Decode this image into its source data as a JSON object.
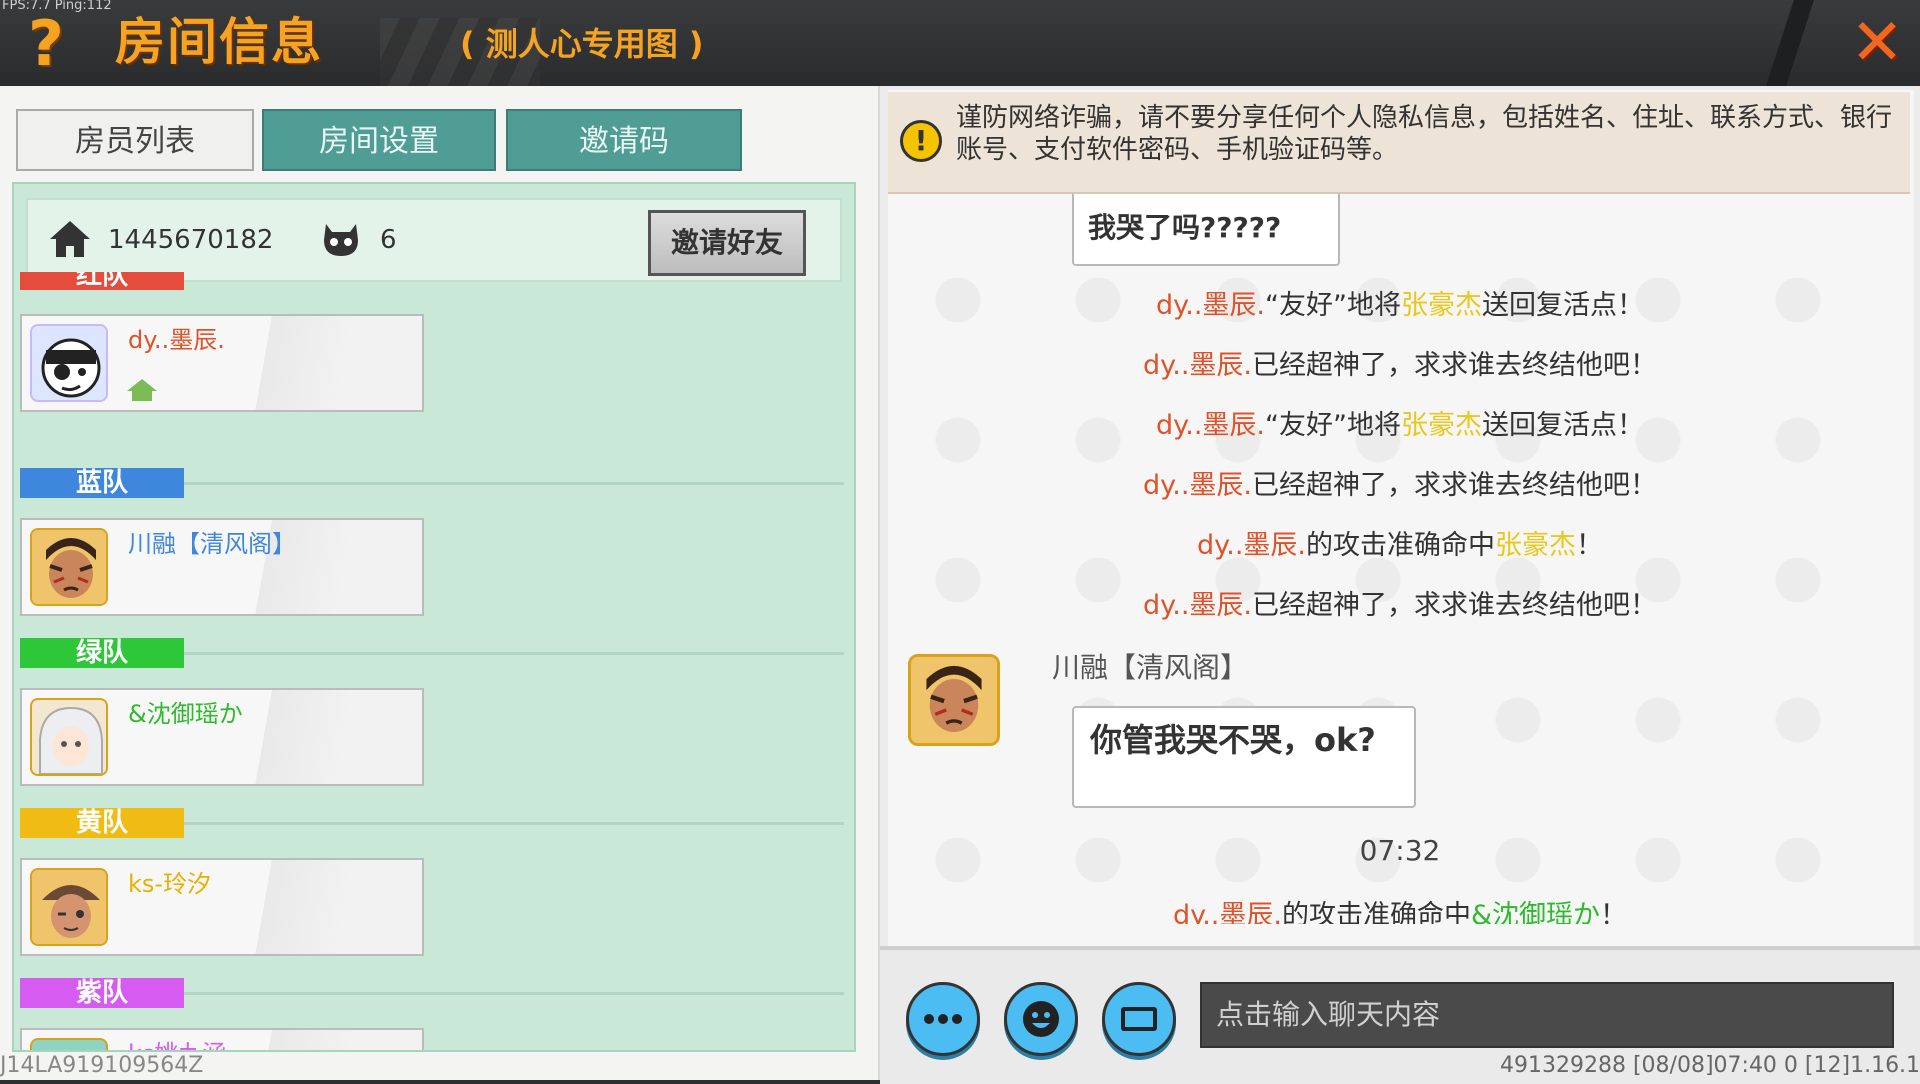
{
  "status": {
    "fps": "FPS:7.7  Ping:112"
  },
  "header": {
    "help_label": "?",
    "title": "房间信息",
    "subtitle": "( 测人心专用图 )",
    "close_label": "✕"
  },
  "tabs": [
    {
      "label": "房员列表",
      "active": true
    },
    {
      "label": "房间设置",
      "active": false
    },
    {
      "label": "邀请码",
      "active": false
    }
  ],
  "room": {
    "id": "1445670182",
    "people": "6",
    "invite_button": "邀请好友"
  },
  "teams": [
    {
      "name": "红队",
      "color": "#e54c3c",
      "members": [
        {
          "name": "dy..墨辰.",
          "color": "#e0522a",
          "avatar_icon": "pirate-avatar-icon"
        }
      ]
    },
    {
      "name": "蓝队",
      "color": "#3f86dd",
      "members": [
        {
          "name": "川融【清风阁】",
          "color": "#3f86dd",
          "avatar_icon": "warrior-avatar-icon"
        }
      ]
    },
    {
      "name": "绿队",
      "color": "#2ec73a",
      "members": [
        {
          "name": "&沈御瑶か",
          "color": "#2dbb2d",
          "avatar_icon": "white-hair-avatar-icon"
        }
      ]
    },
    {
      "name": "黄队",
      "color": "#f0bb12",
      "members": [
        {
          "name": "ks-玲汐",
          "color": "#e8b000",
          "avatar_icon": "hat-girl-avatar-icon"
        }
      ]
    },
    {
      "name": "紫队",
      "color": "#d65bf0",
      "members": [
        {
          "name": "ks姚九涵",
          "color": "#d65bf0",
          "avatar_icon": "avatar-icon"
        }
      ]
    }
  ],
  "warning": {
    "icon": "exclamation-icon",
    "text": "谨防网络诈骗，请不要分享任何个人隐私信息，包括姓名、住址、联系方式、银行账号、支付软件密码、手机验证码等。"
  },
  "chat": {
    "partial_bubble": "我哭了吗?????",
    "lines": [
      {
        "name": "dy..墨辰.",
        "mid": "“友好”地将",
        "target": "张豪杰",
        "end": "送回复活点！"
      },
      {
        "name": "dy..墨辰.",
        "mid": "已经超神了，求求谁去终结他吧！",
        "target": "",
        "end": ""
      },
      {
        "name": "dy..墨辰.",
        "mid": "“友好”地将",
        "target": "张豪杰",
        "end": "送回复活点！"
      },
      {
        "name": "dy..墨辰.",
        "mid": "已经超神了，求求谁去终结他吧！",
        "target": "",
        "end": ""
      },
      {
        "name": "dy..墨辰.",
        "mid": "的攻击准确命中",
        "target": "张豪杰",
        "end": "！"
      },
      {
        "name": "dy..墨辰.",
        "mid": "已经超神了，求求谁去终结他吧！",
        "target": "",
        "end": ""
      }
    ],
    "speaker": "川融【清风阁】",
    "message": "你管我哭不哭，ok?",
    "time": "07:32",
    "last_line": {
      "name": "dy..墨辰.",
      "mid": "的攻击准确命中",
      "target": "&沈御瑶か",
      "end": "！"
    }
  },
  "input": {
    "placeholder": "点击输入聊天内容",
    "more_icon": "more-icon",
    "emoji_icon": "emoji-icon",
    "keyboard_icon": "keyboard-icon"
  },
  "footer": {
    "device": "J14LA919109564Z",
    "info": "491329288   [08/08]07:40 0   [12]1.16.1"
  }
}
